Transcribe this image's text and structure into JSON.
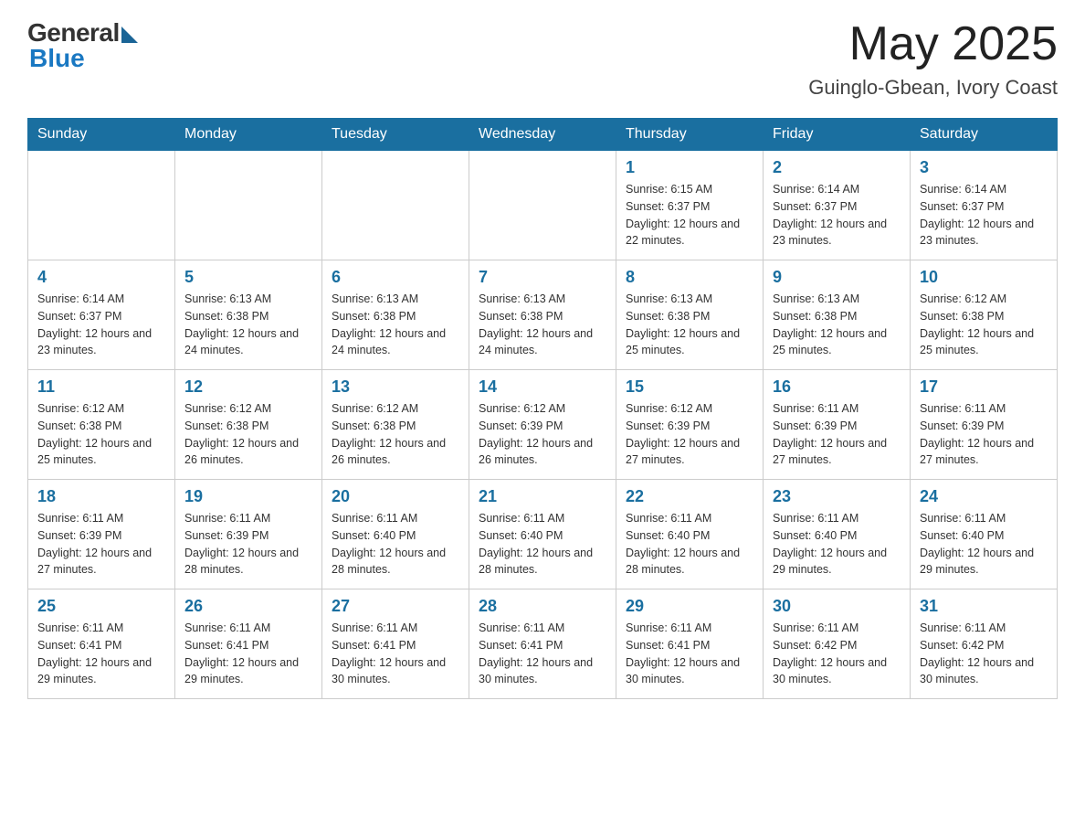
{
  "header": {
    "logo_general": "General",
    "logo_blue": "Blue",
    "title": "May 2025",
    "subtitle": "Guinglo-Gbean, Ivory Coast"
  },
  "days_of_week": [
    "Sunday",
    "Monday",
    "Tuesday",
    "Wednesday",
    "Thursday",
    "Friday",
    "Saturday"
  ],
  "weeks": [
    [
      {
        "day": "",
        "info": ""
      },
      {
        "day": "",
        "info": ""
      },
      {
        "day": "",
        "info": ""
      },
      {
        "day": "",
        "info": ""
      },
      {
        "day": "1",
        "info": "Sunrise: 6:15 AM\nSunset: 6:37 PM\nDaylight: 12 hours and 22 minutes."
      },
      {
        "day": "2",
        "info": "Sunrise: 6:14 AM\nSunset: 6:37 PM\nDaylight: 12 hours and 23 minutes."
      },
      {
        "day": "3",
        "info": "Sunrise: 6:14 AM\nSunset: 6:37 PM\nDaylight: 12 hours and 23 minutes."
      }
    ],
    [
      {
        "day": "4",
        "info": "Sunrise: 6:14 AM\nSunset: 6:37 PM\nDaylight: 12 hours and 23 minutes."
      },
      {
        "day": "5",
        "info": "Sunrise: 6:13 AM\nSunset: 6:38 PM\nDaylight: 12 hours and 24 minutes."
      },
      {
        "day": "6",
        "info": "Sunrise: 6:13 AM\nSunset: 6:38 PM\nDaylight: 12 hours and 24 minutes."
      },
      {
        "day": "7",
        "info": "Sunrise: 6:13 AM\nSunset: 6:38 PM\nDaylight: 12 hours and 24 minutes."
      },
      {
        "day": "8",
        "info": "Sunrise: 6:13 AM\nSunset: 6:38 PM\nDaylight: 12 hours and 25 minutes."
      },
      {
        "day": "9",
        "info": "Sunrise: 6:13 AM\nSunset: 6:38 PM\nDaylight: 12 hours and 25 minutes."
      },
      {
        "day": "10",
        "info": "Sunrise: 6:12 AM\nSunset: 6:38 PM\nDaylight: 12 hours and 25 minutes."
      }
    ],
    [
      {
        "day": "11",
        "info": "Sunrise: 6:12 AM\nSunset: 6:38 PM\nDaylight: 12 hours and 25 minutes."
      },
      {
        "day": "12",
        "info": "Sunrise: 6:12 AM\nSunset: 6:38 PM\nDaylight: 12 hours and 26 minutes."
      },
      {
        "day": "13",
        "info": "Sunrise: 6:12 AM\nSunset: 6:38 PM\nDaylight: 12 hours and 26 minutes."
      },
      {
        "day": "14",
        "info": "Sunrise: 6:12 AM\nSunset: 6:39 PM\nDaylight: 12 hours and 26 minutes."
      },
      {
        "day": "15",
        "info": "Sunrise: 6:12 AM\nSunset: 6:39 PM\nDaylight: 12 hours and 27 minutes."
      },
      {
        "day": "16",
        "info": "Sunrise: 6:11 AM\nSunset: 6:39 PM\nDaylight: 12 hours and 27 minutes."
      },
      {
        "day": "17",
        "info": "Sunrise: 6:11 AM\nSunset: 6:39 PM\nDaylight: 12 hours and 27 minutes."
      }
    ],
    [
      {
        "day": "18",
        "info": "Sunrise: 6:11 AM\nSunset: 6:39 PM\nDaylight: 12 hours and 27 minutes."
      },
      {
        "day": "19",
        "info": "Sunrise: 6:11 AM\nSunset: 6:39 PM\nDaylight: 12 hours and 28 minutes."
      },
      {
        "day": "20",
        "info": "Sunrise: 6:11 AM\nSunset: 6:40 PM\nDaylight: 12 hours and 28 minutes."
      },
      {
        "day": "21",
        "info": "Sunrise: 6:11 AM\nSunset: 6:40 PM\nDaylight: 12 hours and 28 minutes."
      },
      {
        "day": "22",
        "info": "Sunrise: 6:11 AM\nSunset: 6:40 PM\nDaylight: 12 hours and 28 minutes."
      },
      {
        "day": "23",
        "info": "Sunrise: 6:11 AM\nSunset: 6:40 PM\nDaylight: 12 hours and 29 minutes."
      },
      {
        "day": "24",
        "info": "Sunrise: 6:11 AM\nSunset: 6:40 PM\nDaylight: 12 hours and 29 minutes."
      }
    ],
    [
      {
        "day": "25",
        "info": "Sunrise: 6:11 AM\nSunset: 6:41 PM\nDaylight: 12 hours and 29 minutes."
      },
      {
        "day": "26",
        "info": "Sunrise: 6:11 AM\nSunset: 6:41 PM\nDaylight: 12 hours and 29 minutes."
      },
      {
        "day": "27",
        "info": "Sunrise: 6:11 AM\nSunset: 6:41 PM\nDaylight: 12 hours and 30 minutes."
      },
      {
        "day": "28",
        "info": "Sunrise: 6:11 AM\nSunset: 6:41 PM\nDaylight: 12 hours and 30 minutes."
      },
      {
        "day": "29",
        "info": "Sunrise: 6:11 AM\nSunset: 6:41 PM\nDaylight: 12 hours and 30 minutes."
      },
      {
        "day": "30",
        "info": "Sunrise: 6:11 AM\nSunset: 6:42 PM\nDaylight: 12 hours and 30 minutes."
      },
      {
        "day": "31",
        "info": "Sunrise: 6:11 AM\nSunset: 6:42 PM\nDaylight: 12 hours and 30 minutes."
      }
    ]
  ]
}
